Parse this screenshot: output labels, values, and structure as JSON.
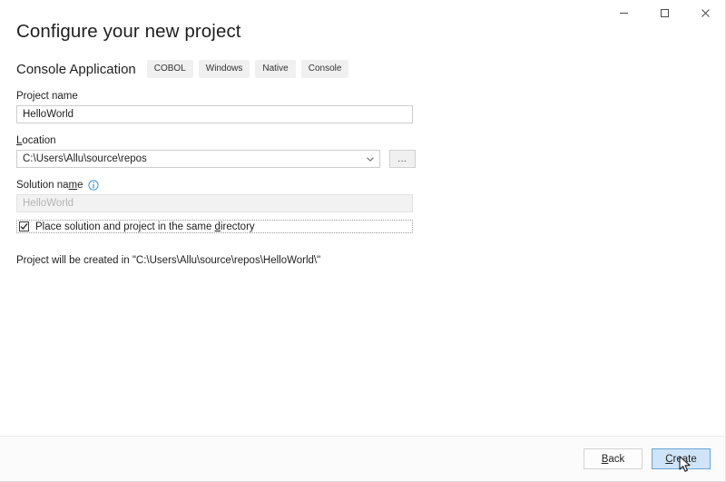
{
  "window": {
    "controls": [
      {
        "name": "minimize",
        "label": "—"
      },
      {
        "name": "maximize",
        "label": "□"
      },
      {
        "name": "close",
        "label": "✕"
      }
    ]
  },
  "header": {
    "title": "Configure your new project",
    "template_name": "Console Application",
    "tags": [
      "COBOL",
      "Windows",
      "Native",
      "Console"
    ]
  },
  "form": {
    "project_name": {
      "label": "Project name",
      "value": "HelloWorld",
      "placeholder": ""
    },
    "location": {
      "label_pre": "",
      "label_accel": "L",
      "label_post": "ocation",
      "value": "C:\\Users\\Allu\\source\\repos",
      "browse_label": "...",
      "dropdown_icon": "chevron-down-icon"
    },
    "solution_name": {
      "label_pre": "Solution na",
      "label_accel": "m",
      "label_post": "e",
      "value": "HelloWorld",
      "disabled": true,
      "info_icon": "info-circle-icon"
    },
    "same_directory_checkbox": {
      "checked": true,
      "label_pre": "Place solution and project in the same ",
      "label_accel": "d",
      "label_post": "irectory"
    },
    "path_note": "Project will be created in \"C:\\Users\\Allu\\source\\repos\\HelloWorld\\\""
  },
  "footer": {
    "back": {
      "pre": "",
      "accel": "B",
      "post": "ack"
    },
    "create": {
      "pre": "",
      "accel": "C",
      "post": "reate"
    }
  },
  "colors": {
    "accent": "#0078d4",
    "primary_button_bg": "#cfe4f7",
    "primary_button_border": "#6ba3d6",
    "tag_bg": "#f0f0f0",
    "footer_bg": "#fbfbfb"
  }
}
